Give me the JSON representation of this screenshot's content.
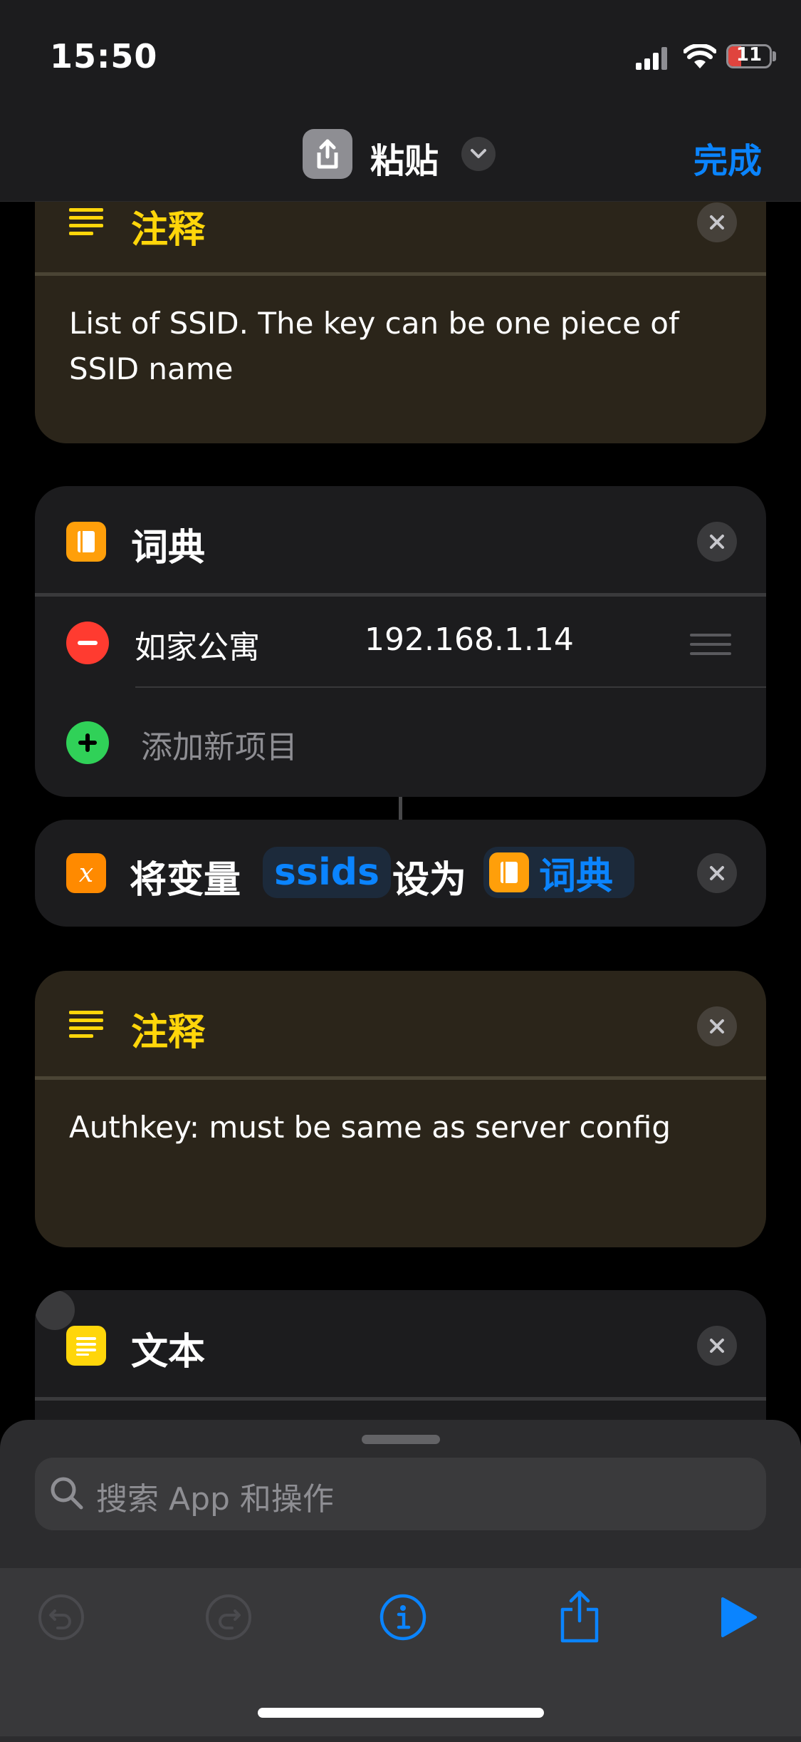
{
  "status_bar": {
    "time": "15:50",
    "battery": "11",
    "battery_level": 0.11
  },
  "nav": {
    "title": "粘贴",
    "done_label": "完成"
  },
  "blocks": {
    "comment1": {
      "title": "注释",
      "text_line1": "List of SSID. The key can be one piece of",
      "text_line2": "SSID name"
    },
    "dictionary": {
      "title": "词典",
      "item": {
        "key": "如家公寓",
        "value": "192.168.1.14"
      },
      "add_label": "添加新项目"
    },
    "set_variable": {
      "prefix": "将变量",
      "variable": "ssids",
      "middle": "设为",
      "value": "词典"
    },
    "comment2": {
      "title": "注释",
      "text": "Authkey: must be same as server config"
    },
    "text_block": {
      "title": "文本"
    }
  },
  "search": {
    "placeholder": "搜索 App 和操作"
  },
  "colors": {
    "accent": "#0a84ff",
    "comment_yellow": "#ffd60a",
    "delete_red": "#ff3b30",
    "add_green": "#30d158"
  }
}
